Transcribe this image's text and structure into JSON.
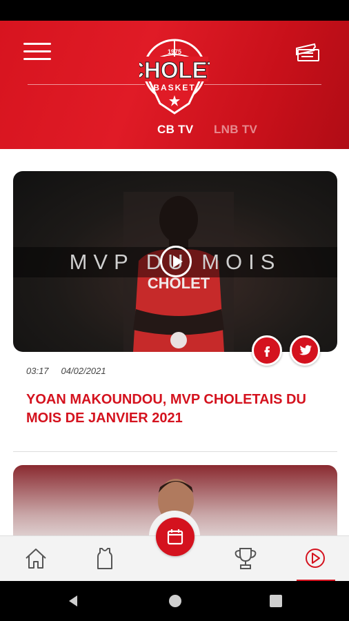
{
  "header": {
    "logo": {
      "top": "1975",
      "name": "CHOLET",
      "sub": "BASKET"
    },
    "tabs": [
      {
        "label": "CB TV",
        "active": true
      },
      {
        "label": "LNB TV",
        "active": false
      }
    ]
  },
  "article": {
    "video_overlay": "MVP DU MOIS",
    "duration": "03:17",
    "date": "04/02/2021",
    "title": "YOAN MAKOUNDOU, MVP CHOLETAIS DU MOIS DE JANVIER 2021",
    "jersey_text": "CHOLET"
  },
  "bottom_nav": {
    "items": [
      {
        "icon": "home-icon"
      },
      {
        "icon": "jersey-icon"
      },
      {
        "icon": "calendar-icon"
      },
      {
        "icon": "trophy-icon"
      },
      {
        "icon": "play-circle-icon",
        "active": true
      }
    ]
  },
  "colors": {
    "brand_red": "#d4121e",
    "header_red": "#e01b26",
    "nav_bg": "#f3f3f3"
  }
}
